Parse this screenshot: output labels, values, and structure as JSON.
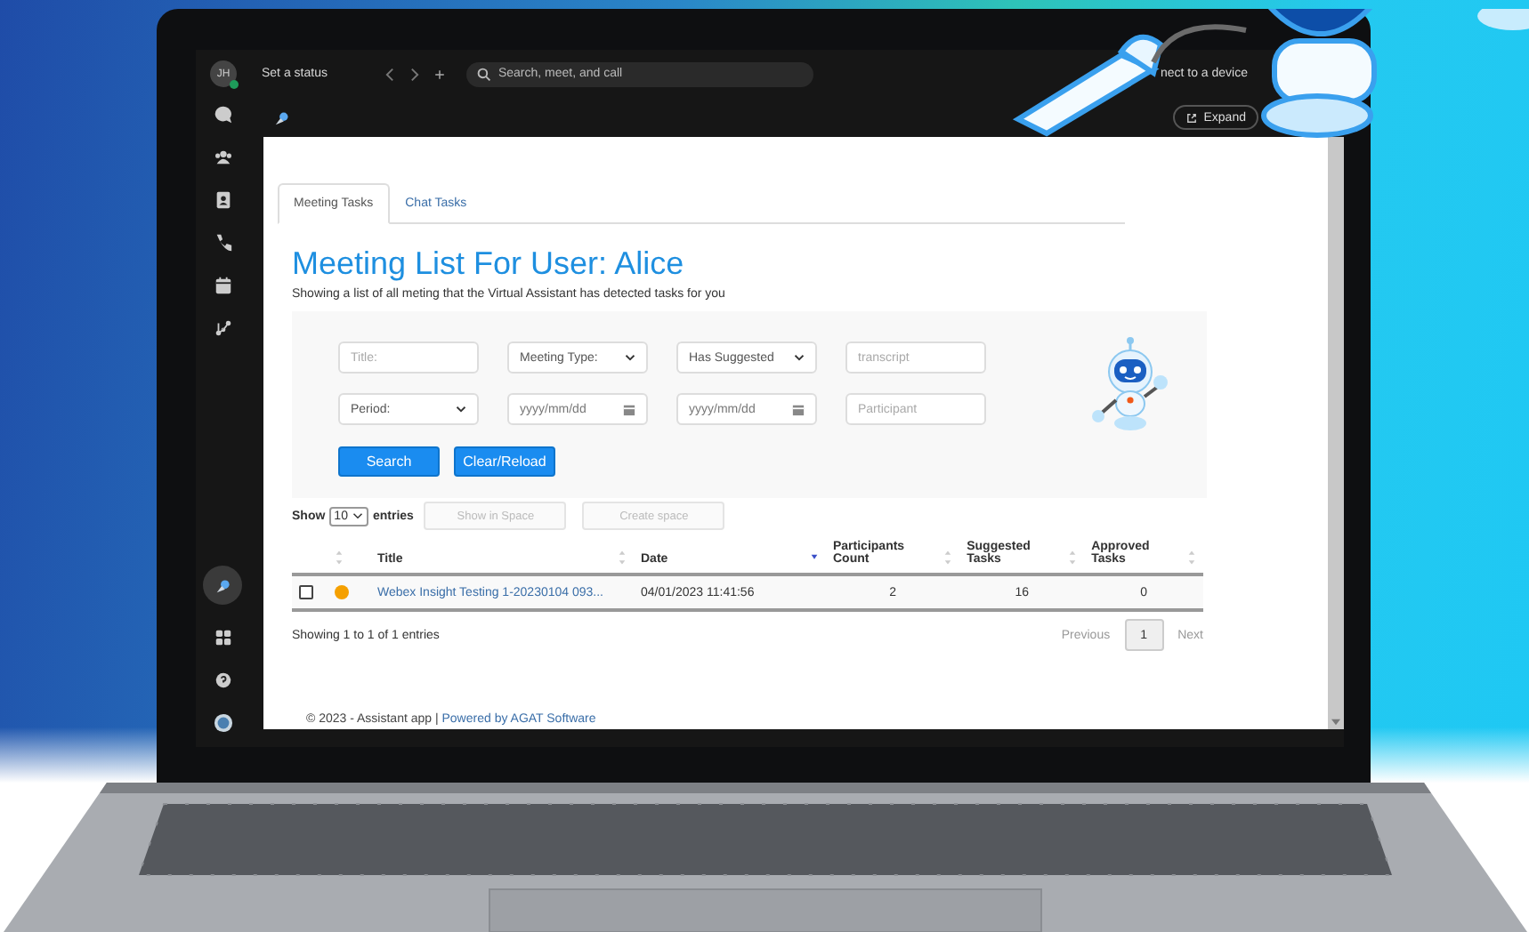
{
  "app_bar": {
    "avatar_initials": "JH",
    "status": "Set a status",
    "search": {
      "placeholder": "Search, meet, and call"
    },
    "device": "nect to a device"
  },
  "rail": [
    {
      "kind": "chat",
      "selected": false
    },
    {
      "kind": "teams",
      "selected": false
    },
    {
      "kind": "contacts",
      "selected": false
    },
    {
      "kind": "calls",
      "selected": false
    },
    {
      "kind": "calendar",
      "selected": false
    },
    {
      "kind": "nodes",
      "selected": false
    }
  ],
  "rail_bottom": [
    {
      "kind": "assistant",
      "selected": true
    },
    {
      "kind": "apps",
      "selected": false
    },
    {
      "kind": "help",
      "selected": false
    },
    {
      "kind": "avatar",
      "selected": false
    }
  ],
  "header": {
    "expand": "Expand"
  },
  "tabs": [
    {
      "label": "Meeting Tasks",
      "selected": true
    },
    {
      "label": "Chat Tasks",
      "selected": false
    }
  ],
  "heading": "Meeting List For User: Alice",
  "subtitle": "Showing a list of all meting that the Virtual Assistant has detected tasks for you",
  "filters": [
    {
      "kind": "text",
      "placeholder": "Title:"
    },
    {
      "kind": "select",
      "value": "Meeting Type:"
    },
    {
      "kind": "select",
      "value": "Has Suggested"
    },
    {
      "kind": "text",
      "placeholder": "transcript"
    },
    {
      "kind": "select",
      "value": "Period:"
    },
    {
      "kind": "date",
      "placeholder": "yyyy/mm/dd"
    },
    {
      "kind": "date",
      "placeholder": "yyyy/mm/dd"
    },
    {
      "kind": "text",
      "placeholder": "Participant"
    }
  ],
  "filter_buttons": [
    "Search",
    "Clear/Reload"
  ],
  "page_length": {
    "label_before": "Show",
    "value": "10",
    "label_after": "entries"
  },
  "actions": [
    {
      "label": "Show in Space",
      "disabled": true
    },
    {
      "label": "Create space",
      "disabled": true
    }
  ],
  "table": {
    "columns": [
      {
        "label": "Title",
        "sorted": false
      },
      {
        "label": "Date",
        "sorted": true
      },
      {
        "label": "Participants Count",
        "sorted": false
      },
      {
        "label": "Suggested Tasks",
        "sorted": false
      },
      {
        "label": "Approved Tasks",
        "sorted": false
      }
    ],
    "rows": [
      {
        "checked": false,
        "color": "#f5a000",
        "title": "Webex Insight Testing 1-20230104 093...",
        "date": "04/01/2023 11:41:56",
        "participants": "2",
        "suggested": "16",
        "approved": "0"
      }
    ]
  },
  "info": "Showing 1 to 1 of 1 entries",
  "pagination": {
    "previous": "Previous",
    "pages": [
      {
        "label": "1",
        "selected": true
      }
    ],
    "next": "Next"
  },
  "footer": {
    "text": "© 2023 - Assistant app |",
    "link": "Powered by AGAT Software"
  }
}
